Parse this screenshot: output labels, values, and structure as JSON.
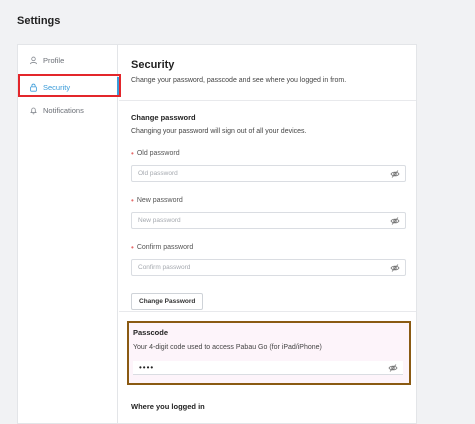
{
  "page": {
    "title": "Settings"
  },
  "sidebar": {
    "items": [
      {
        "label": "Profile",
        "icon": "user-icon"
      },
      {
        "label": "Security",
        "icon": "lock-icon",
        "active": true
      },
      {
        "label": "Notifications",
        "icon": "bell-icon"
      }
    ]
  },
  "security": {
    "title": "Security",
    "description": "Change your password, passcode and see where you logged in from."
  },
  "change_password": {
    "title": "Change password",
    "description": "Changing your password will sign out of all your devices.",
    "old_label": "Old password",
    "old_placeholder": "Old password",
    "new_label": "New password",
    "new_placeholder": "New password",
    "confirm_label": "Confirm password",
    "confirm_placeholder": "Confirm password",
    "button_label": "Change Password"
  },
  "passcode": {
    "title": "Passcode",
    "description": "Your 4-digit code used to access Pabau Go (for iPad/iPhone)",
    "value": "••••"
  },
  "where_logged_in": {
    "title": "Where you logged in"
  },
  "colors": {
    "accent": "#3a9bd9",
    "highlight_red": "#e3262b",
    "highlight_brown": "#8a5a12",
    "required": "#e56b6b"
  }
}
